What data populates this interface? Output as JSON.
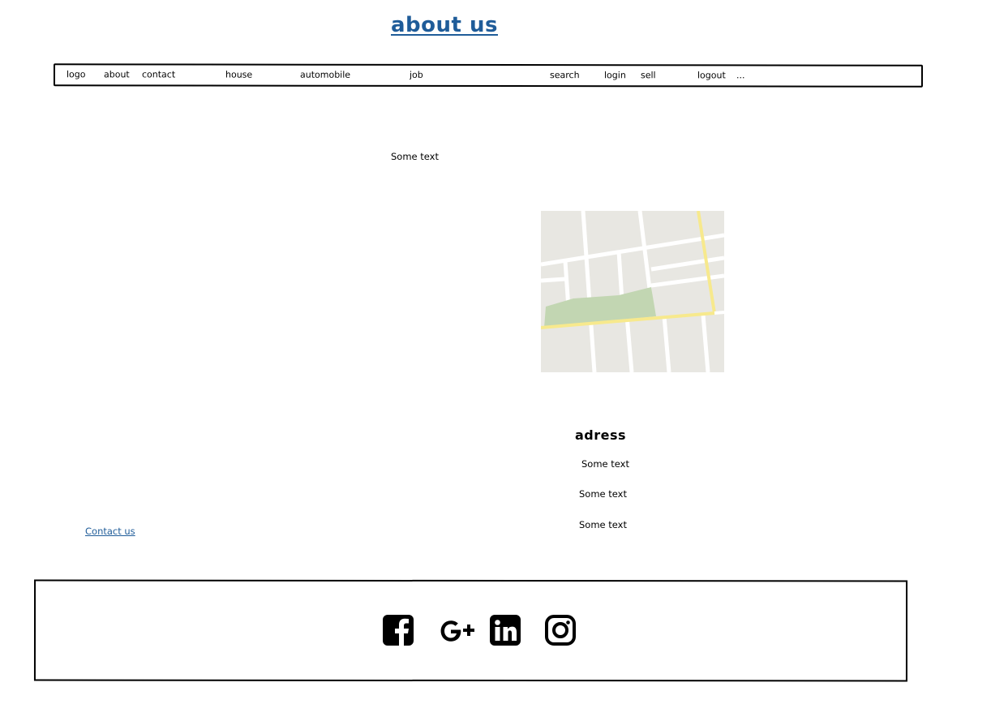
{
  "header": {
    "title": "about us"
  },
  "nav": {
    "items": [
      {
        "key": "logo",
        "label": "logo"
      },
      {
        "key": "about",
        "label": "about"
      },
      {
        "key": "contact",
        "label": "contact"
      },
      {
        "key": "house",
        "label": "house"
      },
      {
        "key": "automobile",
        "label": "automobile"
      },
      {
        "key": "job",
        "label": "job"
      },
      {
        "key": "search",
        "label": "search"
      },
      {
        "key": "login",
        "label": "login"
      },
      {
        "key": "sell",
        "label": "sell"
      },
      {
        "key": "logout",
        "label": "logout"
      },
      {
        "key": "more",
        "label": "..."
      }
    ]
  },
  "main": {
    "intro_text": "Some text",
    "map_icon": "map-image",
    "address": {
      "heading": "adress",
      "lines": [
        "Some text",
        "Some text",
        "Some text"
      ]
    },
    "contact_link": "Contact us"
  },
  "footer": {
    "social": [
      {
        "name": "facebook-icon"
      },
      {
        "name": "google-plus-icon"
      },
      {
        "name": "linkedin-icon"
      },
      {
        "name": "instagram-icon"
      }
    ]
  },
  "colors": {
    "link": "#1f5c99",
    "map_block": "#e8e7e2",
    "map_park": "#c2d6b2",
    "map_road_major": "#f7e98d"
  }
}
